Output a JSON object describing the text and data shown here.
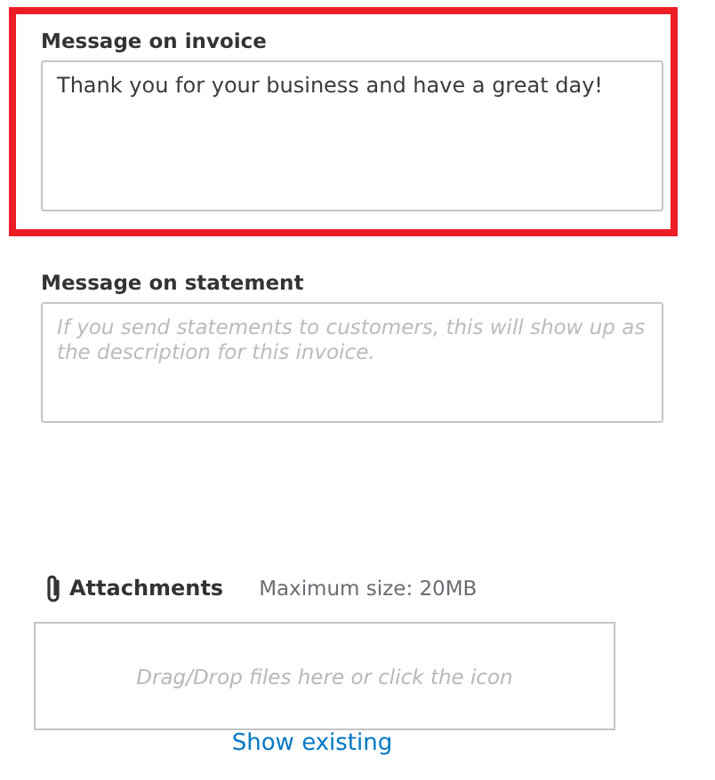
{
  "fields": [
    {
      "label": "Message on invoice",
      "value": "Thank you for your business and have a great day!",
      "highlighted": true
    },
    {
      "label": "Message on statement",
      "placeholder": "If you send statements to customers, this will show up as the description for this invoice.",
      "highlighted": false
    }
  ],
  "attachments": {
    "title": "Attachments",
    "limit": "Maximum size: 20MB",
    "dropzone": "Drag/Drop files here or click the icon",
    "link": "Show existing"
  }
}
